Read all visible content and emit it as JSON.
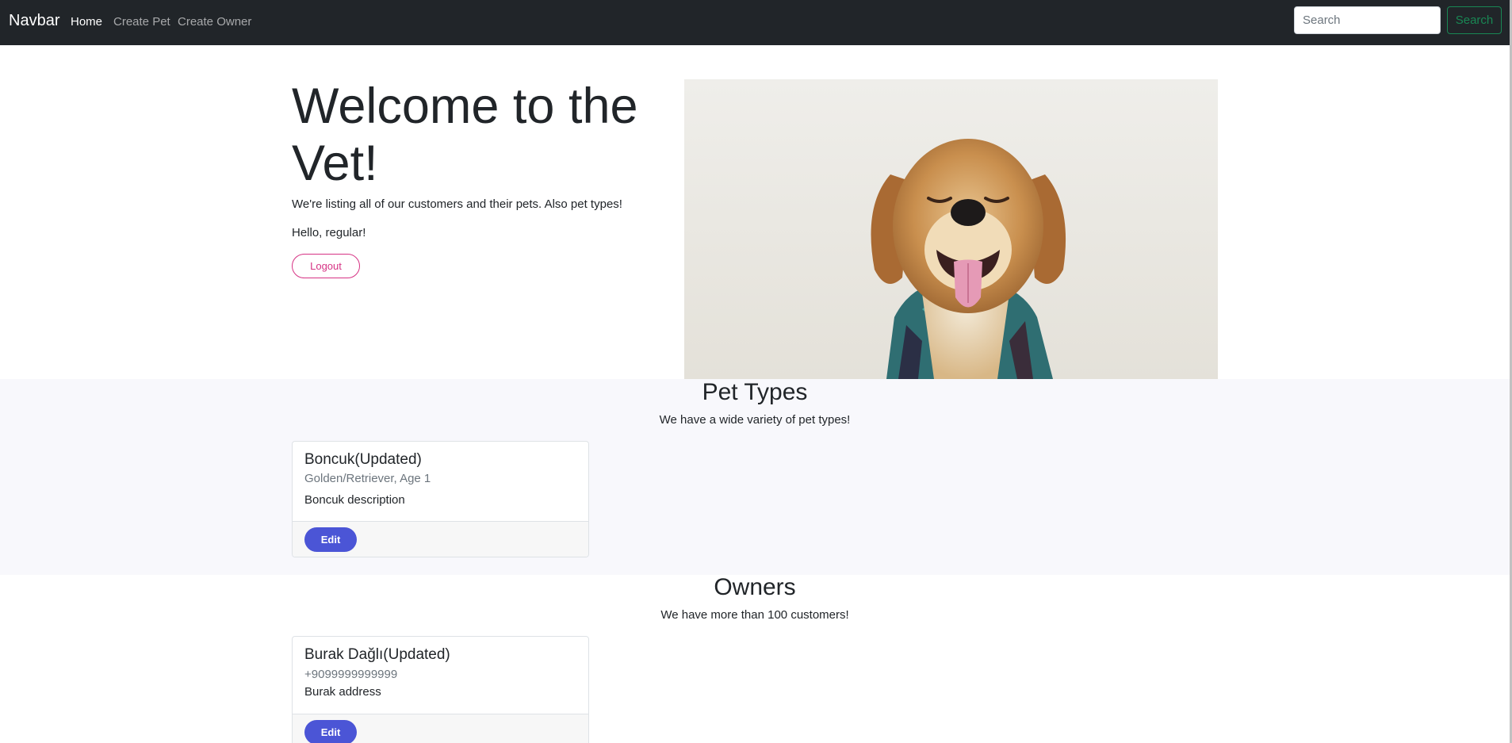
{
  "navbar": {
    "brand": "Navbar",
    "links": [
      "Home",
      "Create Pet",
      "Create Owner"
    ],
    "search_placeholder": "Search",
    "search_button": "Search"
  },
  "hero": {
    "title": "Welcome to the Vet!",
    "lead": "We're listing all of our customers and their pets. Also pet types!",
    "greeting": "Hello, regular!",
    "logout_label": "Logout"
  },
  "pet_types": {
    "title": "Pet Types",
    "subtitle": "We have a wide variety of pet types!",
    "cards": [
      {
        "name": "Boncuk(Updated)",
        "meta": "Golden/Retriever, Age 1",
        "description": "Boncuk description",
        "edit_label": "Edit"
      }
    ]
  },
  "owners": {
    "title": "Owners",
    "subtitle": "We have more than 100 customers!",
    "cards": [
      {
        "name": "Burak Dağlı(Updated)",
        "phone": "+9099999999999",
        "address": "Burak address",
        "edit_label": "Edit"
      }
    ]
  },
  "colors": {
    "navbar_bg": "#212529",
    "search_green": "#198754",
    "logout_pink": "#d63384",
    "edit_blue": "#4b55d6",
    "section_bg": "#f8f8fc"
  }
}
